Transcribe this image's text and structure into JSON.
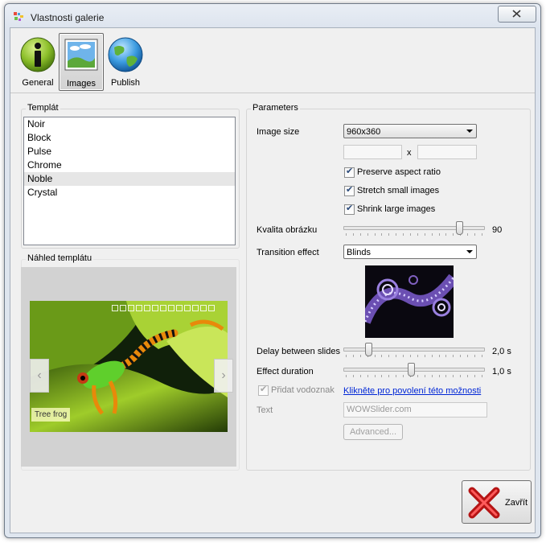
{
  "window": {
    "title": "Vlastnosti galerie"
  },
  "toolbar": {
    "general": "General",
    "images": "Images",
    "publish": "Publish"
  },
  "template": {
    "label": "Templát",
    "items": [
      "Noir",
      "Block",
      "Pulse",
      "Chrome",
      "Noble",
      "Crystal"
    ],
    "selected": "Noble"
  },
  "preview": {
    "label": "Náhled templátu",
    "caption": "Tree frog"
  },
  "params": {
    "label": "Parameters",
    "image_size_label": "Image size",
    "image_size_value": "960x360",
    "width_value": "",
    "x_sep": "x",
    "height_value": "",
    "preserve_label": "Preserve aspect ratio",
    "preserve_checked": true,
    "stretch_label": "Stretch small images",
    "stretch_checked": true,
    "shrink_label": "Shrink large images",
    "shrink_checked": true,
    "quality_label": "Kvalita obrázku",
    "quality_value": "90",
    "quality_level": 0.9,
    "transition_label": "Transition effect",
    "transition_value": "Blinds",
    "delay_label": "Delay between slides",
    "delay_value": "2,0 s",
    "duration_label": "Effect duration",
    "duration_value": "1,0 s",
    "watermark_label": "Přidat vodoznak",
    "watermark_checked": true,
    "watermark_link": "Klikněte pro povolení této možnosti",
    "text_label": "Text",
    "text_value": "WOWSlider.com",
    "advanced_label": "Advanced..."
  },
  "footer": {
    "close_label": "Zavřít"
  }
}
